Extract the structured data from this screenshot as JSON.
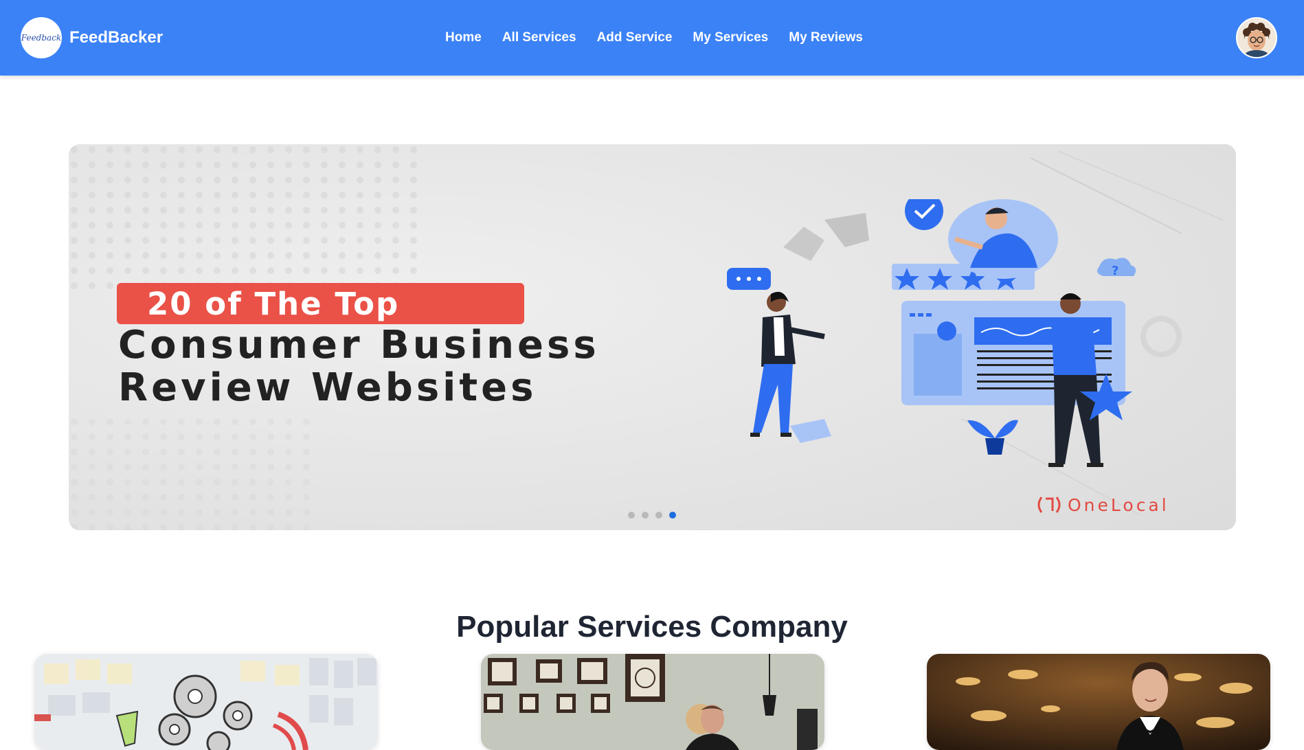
{
  "brand": {
    "logo_text": "Feedback",
    "name": "FeedBacker"
  },
  "nav": {
    "items": [
      {
        "label": "Home"
      },
      {
        "label": "All Services"
      },
      {
        "label": "Add Service"
      },
      {
        "label": "My Services"
      },
      {
        "label": "My Reviews"
      }
    ]
  },
  "user": {
    "avatar_icon": "user-avatar-icon"
  },
  "hero": {
    "tag": "20 of The Top",
    "title_line1": "Consumer Business",
    "title_line2": "Review Websites",
    "brand": "OneLocal",
    "slide_count": 4,
    "active_slide": 4
  },
  "section": {
    "title": "Popular Services Company"
  },
  "cards": [
    {
      "image": "gears-sticky-notes-image"
    },
    {
      "image": "man-in-room-with-frames-image"
    },
    {
      "image": "waiter-in-restaurant-image"
    }
  ],
  "colors": {
    "nav_bg": "#3b82f6",
    "accent_red": "#ea5147",
    "dot_active": "#1e6fe0"
  }
}
